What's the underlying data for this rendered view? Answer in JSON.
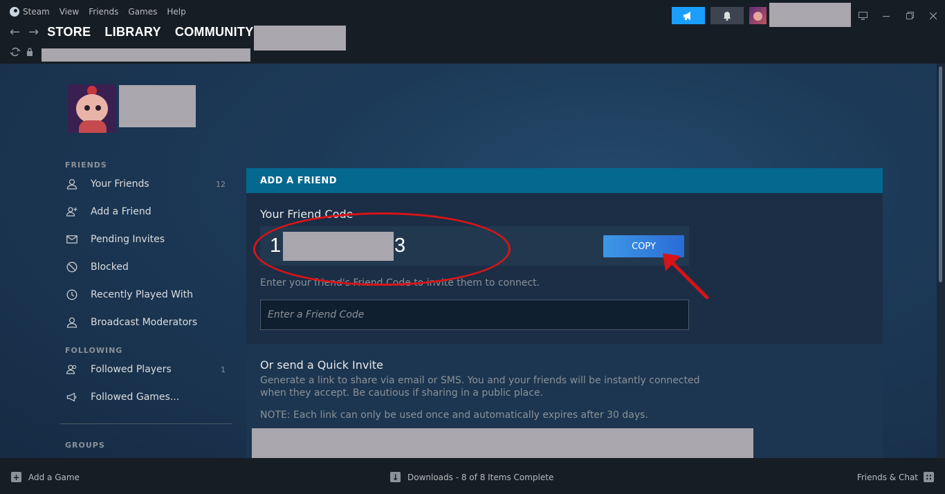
{
  "menu": {
    "steam": "Steam",
    "view": "View",
    "friends": "Friends",
    "games": "Games",
    "help": "Help"
  },
  "nav": {
    "store": "STORE",
    "library": "LIBRARY",
    "community": "COMMUNITY"
  },
  "sidebar": {
    "friends_header": "FRIENDS",
    "items": [
      {
        "label": "Your Friends",
        "count": "12",
        "icon": "person-icon"
      },
      {
        "label": "Add a Friend",
        "icon": "add-person-icon"
      },
      {
        "label": "Pending Invites",
        "icon": "envelope-icon"
      },
      {
        "label": "Blocked",
        "icon": "blocked-icon"
      },
      {
        "label": "Recently Played With",
        "icon": "clock-icon"
      },
      {
        "label": "Broadcast Moderators",
        "icon": "person-icon"
      }
    ],
    "following_header": "FOLLOWING",
    "following_items": [
      {
        "label": "Followed Players",
        "count": "1",
        "icon": "people-icon"
      },
      {
        "label": "Followed Games...",
        "icon": "megaphone-icon"
      }
    ],
    "groups_header": "GROUPS"
  },
  "panel": {
    "header": "ADD A FRIEND",
    "friend_code_label": "Your Friend Code",
    "friend_code_start": "1",
    "friend_code_end": "3",
    "copy_label": "COPY",
    "hint": "Enter your friend's Friend Code to invite them to connect.",
    "input_placeholder": "Enter a Friend Code",
    "quick_invite_title": "Or send a Quick Invite",
    "quick_invite_desc": "Generate a link to share via email or SMS. You and your friends will be instantly connected when they accept. Be cautious if sharing in a public place.",
    "quick_invite_note": "NOTE: Each link can only be used once and automatically expires after 30 days."
  },
  "bottom": {
    "add_game": "Add a Game",
    "downloads": "Downloads - 8 of 8 Items Complete",
    "friends_chat": "Friends & Chat"
  },
  "colors": {
    "accent": "#1a9fff",
    "panel_header": "#05688f",
    "annotation": "#d71418"
  }
}
